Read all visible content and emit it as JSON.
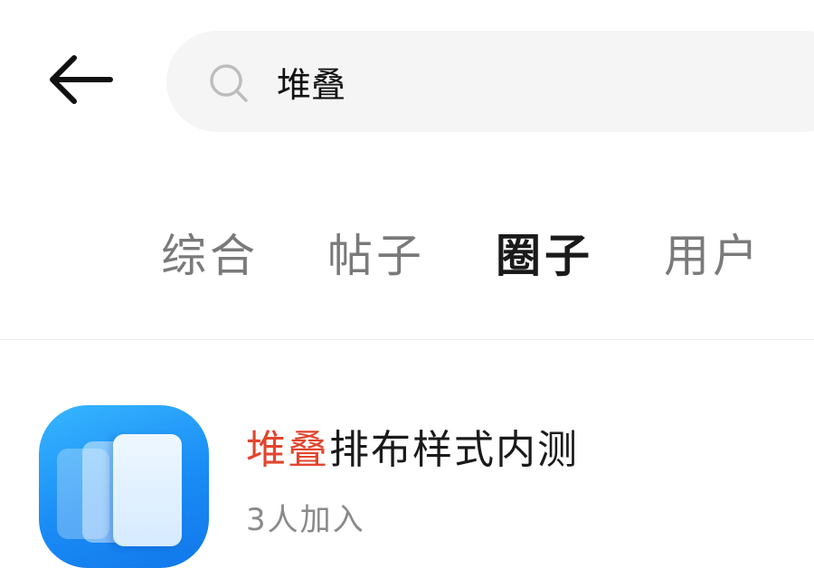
{
  "header": {
    "back_icon": "arrow-left-icon",
    "search": {
      "icon": "search-icon",
      "value": "堆叠",
      "placeholder": ""
    }
  },
  "tabs": [
    {
      "label": "综合",
      "active": false
    },
    {
      "label": "帖子",
      "active": false
    },
    {
      "label": "圈子",
      "active": true
    },
    {
      "label": "用户",
      "active": false
    }
  ],
  "results": [
    {
      "title_highlight": "堆叠",
      "title_rest": "排布样式内测",
      "members": "3人加入",
      "avatar_icon": "stacked-cards-icon"
    }
  ],
  "colors": {
    "highlight": "#e2452f",
    "avatar_gradient_start": "#37b6ff",
    "avatar_gradient_end": "#1177ea",
    "search_background": "#f5f5f5"
  }
}
